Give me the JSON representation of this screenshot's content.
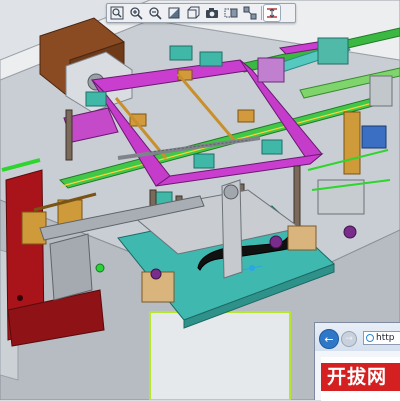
{
  "toolbar": {
    "buttons": [
      {
        "name": "zoom-fit-icon",
        "tooltip": ""
      },
      {
        "name": "zoom-in-icon",
        "tooltip": ""
      },
      {
        "name": "zoom-out-icon",
        "tooltip": ""
      },
      {
        "name": "shaded-view-icon",
        "tooltip": ""
      },
      {
        "name": "wireframe-view-icon",
        "tooltip": ""
      },
      {
        "name": "screenshot-camera-icon",
        "tooltip": ""
      },
      {
        "name": "section-view-icon",
        "tooltip": ""
      },
      {
        "name": "explode-icon",
        "tooltip": ""
      },
      {
        "name": "measure-icon",
        "tooltip": ""
      }
    ],
    "active_index": 8
  },
  "browser": {
    "address_text": "http",
    "site_logo_text": "开拔网",
    "back_icon": "back-arrow-icon",
    "forward_icon": "forward-arrow-icon"
  },
  "colors": {
    "background": "#d9dde2",
    "frame_magenta": "#c93ecf",
    "base_teal": "#3fb8b0",
    "motor_brown": "#8a4a22",
    "mount_red": "#a8141a",
    "rail_green": "#39c639",
    "block_gold": "#d29a3c",
    "accent_blue": "#3a6fc4"
  }
}
